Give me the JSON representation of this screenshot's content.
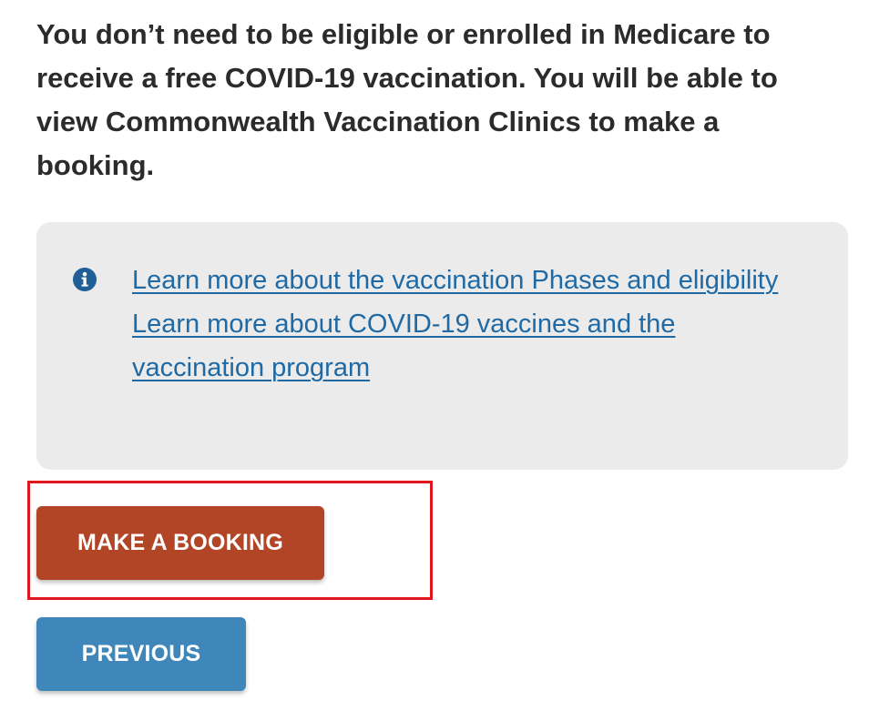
{
  "intro": {
    "text": "You don’t need to be eligible or enrolled in Medicare to receive a free COVID-19 vaccination. You will be able to view Commonwealth Vaccination Clinics to make a booking."
  },
  "info_box": {
    "icon": "info-circle-icon",
    "links": [
      {
        "label": "Learn more about the vaccination Phases and eligibility"
      },
      {
        "label": "Learn more about COVID-19 vaccines and the vaccination program"
      }
    ]
  },
  "actions": {
    "make_booking_label": "MAKE A BOOKING",
    "previous_label": "PREVIOUS"
  },
  "colors": {
    "booking_button": "#b24525",
    "previous_button": "#3f86bb",
    "link": "#1f6aa5",
    "info_box_bg": "#ebebeb",
    "highlight_border": "#e3161e",
    "intro_text": "#2b2b2b"
  }
}
